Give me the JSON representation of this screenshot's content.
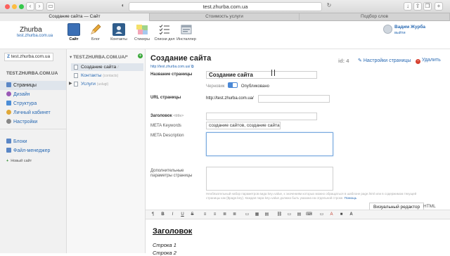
{
  "browser": {
    "url": "test.zhurba.com.ua",
    "tabs": [
      "Создание сайта — Сайт",
      "Стоимость услуги",
      "Подбор слов"
    ],
    "back_icon": "chevron-left-icon",
    "forward_icon": "chevron-right-icon"
  },
  "app": {
    "brand": "Zhurba",
    "brand_url": "test.zhurba.com.ua",
    "modules": [
      {
        "label": "Сайт",
        "icon": "site-icon",
        "color": "#3b6fb5"
      },
      {
        "label": "Блог",
        "icon": "pencil-icon",
        "color": "#e7a93a"
      },
      {
        "label": "Контакты",
        "icon": "contacts-icon",
        "color": "#2f5d8c"
      },
      {
        "label": "Стикеры",
        "icon": "stickers-icon",
        "color": "#e8d74c"
      },
      {
        "label": "Списки дел",
        "icon": "checklist-icon",
        "color": "#bbbbbb"
      },
      {
        "label": "Инсталлер",
        "icon": "installer-icon",
        "color": "#9aa6b2"
      }
    ],
    "user": {
      "name": "Вадим Журба",
      "logout": "выйти"
    }
  },
  "sidebar": {
    "site_switch": "test.zhurba.com.ua",
    "group_title": "TEST.ZHURBA.COM.UA",
    "items": [
      {
        "label": "Страницы",
        "icon": "pages-icon",
        "color": "#5b87c6"
      },
      {
        "label": "Дизайн",
        "icon": "design-icon",
        "color": "#9b59b6"
      },
      {
        "label": "Структура",
        "icon": "structure-icon",
        "color": "#4c8dd6"
      },
      {
        "label": "Личный кабинет",
        "icon": "key-icon",
        "color": "#e0a838"
      },
      {
        "label": "Настройки",
        "icon": "settings-icon",
        "color": "#888888"
      }
    ],
    "items2": [
      {
        "label": "Блоки",
        "icon": "blocks-icon",
        "color": "#5b87c6"
      },
      {
        "label": "Файл-менеджер",
        "icon": "files-icon",
        "color": "#5b87c6"
      }
    ],
    "new_site": "Новый сайт"
  },
  "tree": {
    "root": "TEST.ZHURBA.COM.UA/*",
    "items": [
      {
        "label": "Создание сайта",
        "slug": "/"
      },
      {
        "label": "Контакты",
        "slug": "(contacts)"
      },
      {
        "label": "Услуги",
        "slug": "(uslugi)"
      }
    ]
  },
  "page": {
    "title": "Создание сайта",
    "url": "http://test.zhurba.com.ua/",
    "id": "id: 4",
    "settings_link": "Настройки страницы",
    "delete_link": "Удалить",
    "fields": {
      "name_label": "Название страницы",
      "name_value": "Создание сайта",
      "draft_label": "Черновик",
      "published_label": "Опубликовано",
      "url_label": "URL страницы",
      "url_prefix": "http://test.zhurba.com.ua/",
      "heading_label": "Заголовок",
      "heading_hint": "<title>",
      "keywords_label": "META Keywords",
      "keywords_value": "создание сайтов, создание сайта",
      "description_label": "META Description",
      "extra_label": "Дополнительные параметры страницы",
      "extra_hint": "Необязательный набор параметров вида key=value, к значениям которых можно обращаться в шаблоне page.html или в содержимом текущей страницы как {$page.key}. Каждая пара key=value должна быть указана на отдельной строке.",
      "extra_hint_link": "Помощь"
    },
    "editor": {
      "tabs": [
        "Визуальный редактор",
        "HTML"
      ],
      "toolbar": [
        "¶",
        "B",
        "I",
        "U",
        "S",
        "≡",
        "≡",
        "≣",
        "≣",
        "▭",
        "▦",
        "▤",
        "⛓",
        "▭",
        "▤",
        "⌨",
        "▭",
        "A",
        "■",
        "A"
      ],
      "heading": "Заголовок",
      "lines": [
        "Строка 1",
        "Строка 2"
      ]
    }
  }
}
